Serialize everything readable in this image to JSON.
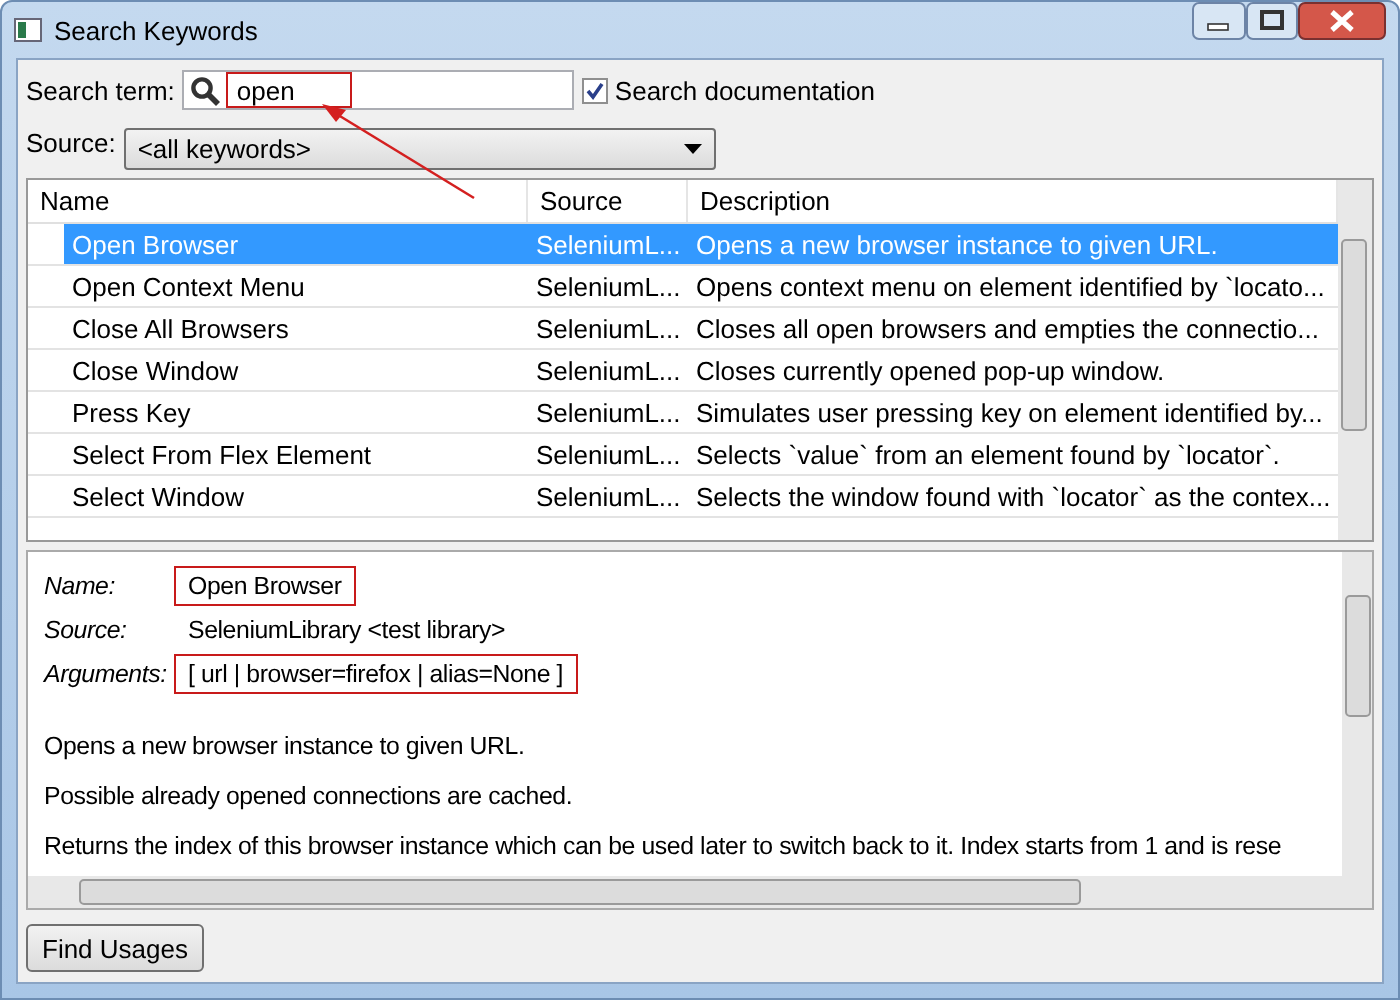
{
  "window": {
    "title": "Search Keywords"
  },
  "search": {
    "label": "Search term:",
    "value": "open",
    "highlighted": true
  },
  "search_documentation": {
    "label": "Search documentation",
    "checked": true
  },
  "source": {
    "label": "Source:",
    "value": "<all keywords>"
  },
  "table": {
    "columns": [
      "Name",
      "Source",
      "Description"
    ],
    "rows": [
      {
        "name": "Open Browser",
        "source": "SeleniumL...",
        "description": "Opens a new browser instance to given URL.",
        "selected": true
      },
      {
        "name": "Open Context Menu",
        "source": "SeleniumL...",
        "description": "Opens context menu on element identified by `locato...",
        "selected": false
      },
      {
        "name": "Close All Browsers",
        "source": "SeleniumL...",
        "description": "Closes all open browsers and empties the connectio...",
        "selected": false
      },
      {
        "name": "Close Window",
        "source": "SeleniumL...",
        "description": "Closes currently opened pop-up window.",
        "selected": false
      },
      {
        "name": "Press Key",
        "source": "SeleniumL...",
        "description": "Simulates user pressing key on element identified by...",
        "selected": false
      },
      {
        "name": "Select From Flex Element",
        "source": "SeleniumL...",
        "description": "Selects `value` from an element found by `locator`.",
        "selected": false
      },
      {
        "name": "Select Window",
        "source": "SeleniumL...",
        "description": "Selects the window found with `locator` as the contex...",
        "selected": false
      }
    ]
  },
  "details": {
    "fields": [
      {
        "label": "Name:",
        "value": "Open Browser",
        "highlighted": true
      },
      {
        "label": "Source:",
        "value": "SeleniumLibrary <test library>",
        "highlighted": false
      },
      {
        "label": "Arguments:",
        "value": "[ url | browser=firefox | alias=None ]",
        "highlighted": true
      }
    ],
    "paragraphs": [
      "Opens a new browser instance to given URL.",
      "Possible already opened connections are cached.",
      "Returns the index of this browser instance which can be used later to switch back to it. Index starts from 1 and is rese"
    ]
  },
  "buttons": [
    "Find Usages"
  ],
  "annotation_arrow": true
}
